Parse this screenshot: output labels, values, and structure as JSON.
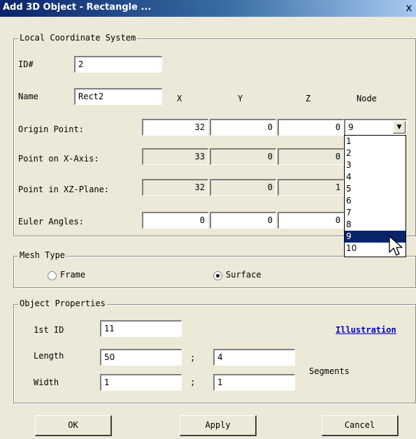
{
  "window": {
    "title": "Add 3D Object - Rectangle ...",
    "close_glyph": "x"
  },
  "local_cs": {
    "legend": "Local Coordinate System",
    "id_label": "ID#",
    "id_value": "2",
    "name_label": "Name",
    "name_value": "Rect2",
    "col_x": "X",
    "col_y": "Y",
    "col_z": "Z",
    "col_node": "Node",
    "rows": [
      {
        "label": "Origin Point:",
        "x": "32",
        "y": "0",
        "z": "0"
      },
      {
        "label": "Point on X-Axis:",
        "x": "33",
        "y": "0",
        "z": "0"
      },
      {
        "label": "Point in XZ-Plane:",
        "x": "32",
        "y": "0",
        "z": "1"
      },
      {
        "label": "Euler Angles:",
        "x": "0",
        "y": "0",
        "z": "0"
      }
    ],
    "node_selected": "9",
    "node_options": [
      "1",
      "2",
      "3",
      "4",
      "5",
      "6",
      "7",
      "8",
      "9",
      "10"
    ]
  },
  "mesh": {
    "legend": "Mesh Type",
    "frame_label": "Frame",
    "surface_label": "Surface",
    "selected": "Surface"
  },
  "props": {
    "legend": "Object Properties",
    "first_id_label": "1st ID",
    "first_id_value": "11",
    "illustration_link": "Illustration",
    "length_label": "Length",
    "length_value": "50",
    "length_segments": "4",
    "width_label": "Width",
    "width_value": "1",
    "width_segments": "1",
    "separator": ";",
    "segments_label": "Segments"
  },
  "buttons": {
    "ok": "OK",
    "apply": "Apply",
    "cancel": "Cancel"
  },
  "icons": {
    "dropdown_arrow": "chevron-down-icon",
    "cursor": "mouse-pointer-icon",
    "radio": "radio-icon"
  }
}
